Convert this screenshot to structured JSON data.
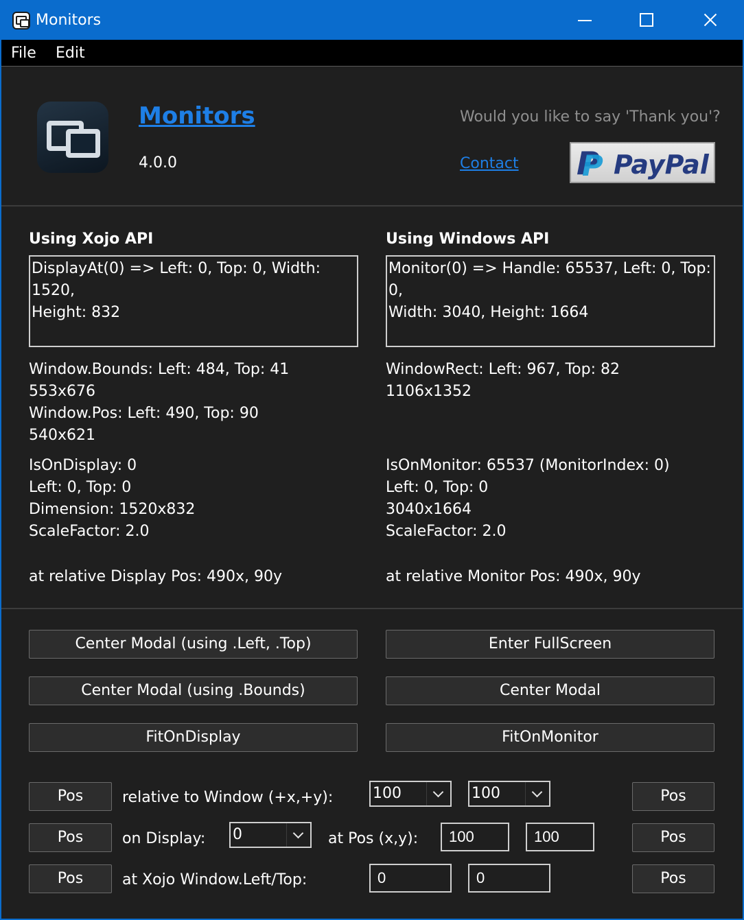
{
  "window": {
    "title": "Monitors"
  },
  "menu": {
    "file": "File",
    "edit": "Edit"
  },
  "header": {
    "app_name": "Monitors",
    "version": "4.0.0",
    "thanks": "Would you like to say 'Thank you'?",
    "contact": "Contact",
    "paypal": "PayPal",
    "paypal_mark": "P"
  },
  "xojo": {
    "heading": "Using Xojo API",
    "display_lines": [
      "DisplayAt(0) => Left: 0, Top: 0, Width: 1520,",
      "Height: 832"
    ],
    "bounds_lines": [
      "Window.Bounds: Left: 484, Top: 41",
      "553x676",
      "Window.Pos: Left: 490, Top: 90",
      "540x621"
    ],
    "display_info_lines": [
      "IsOnDisplay: 0",
      "Left: 0, Top: 0",
      "Dimension: 1520x832",
      "ScaleFactor: 2.0"
    ],
    "relative_pos": "at relative Display Pos: 490x, 90y"
  },
  "windows": {
    "heading": "Using Windows API",
    "monitor_lines": [
      "Monitor(0) => Handle: 65537, Left: 0, Top: 0,",
      "Width: 3040, Height: 1664"
    ],
    "rect_lines": [
      "WindowRect: Left: 967, Top: 82",
      "1106x1352"
    ],
    "monitor_info_lines": [
      "IsOnMonitor: 65537 (MonitorIndex: 0)",
      "Left: 0, Top: 0",
      "3040x1664",
      "ScaleFactor: 2.0"
    ],
    "relative_pos": "at relative Monitor Pos: 490x, 90y"
  },
  "buttons": {
    "center_left_top": "Center Modal (using .Left, .Top)",
    "center_bounds": "Center Modal (using .Bounds)",
    "fit_on_display": "FitOnDisplay",
    "enter_fullscreen": "Enter FullScreen",
    "center_modal": "Center Modal",
    "fit_on_monitor": "FitOnMonitor",
    "pos": "Pos"
  },
  "rows": {
    "relative_label": "relative to Window (+x,+y):",
    "relative_x": "100",
    "relative_y": "100",
    "display_label": "on Display:",
    "display_index": "0",
    "at_pos_label": "at Pos (x,y):",
    "pos_x": "100",
    "pos_y": "100",
    "xojo_label": "at Xojo Window.Left/Top:",
    "left_value": "0",
    "top_value": "0"
  }
}
